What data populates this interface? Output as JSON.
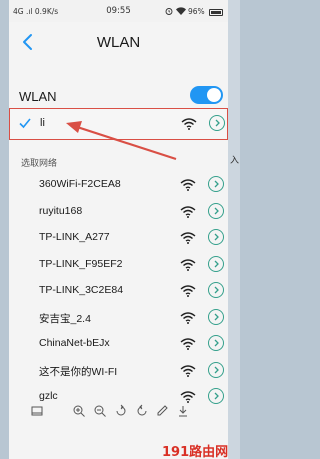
{
  "status_bar": {
    "left": "4G .ıl 0.9K/s",
    "time": "09:55",
    "battery": "96%"
  },
  "header": {
    "title": "WLAN"
  },
  "wlan_toggle": {
    "label": "WLAN",
    "state": "on"
  },
  "connected": {
    "name": "li"
  },
  "section_label": "选取网络",
  "networks": [
    {
      "name": "360WiFi-F2CEA8"
    },
    {
      "name": "ruyitu168"
    },
    {
      "name": "TP-LINK_A277"
    },
    {
      "name": "TP-LINK_F95EF2"
    },
    {
      "name": "TP-LINK_3C2E84"
    },
    {
      "name": "安吉宝_2.4"
    },
    {
      "name": "ChinaNet-bEJx"
    },
    {
      "name": "这不是你的WI-FI"
    },
    {
      "name": "gzlc"
    }
  ],
  "watermark": "191路由网",
  "background_fragment_right_mid": "入",
  "colors": {
    "accent": "#2196f3",
    "info_icon": "#35a08c",
    "highlight_border": "#d94f45",
    "annotation_arrow": "#d94f45"
  }
}
